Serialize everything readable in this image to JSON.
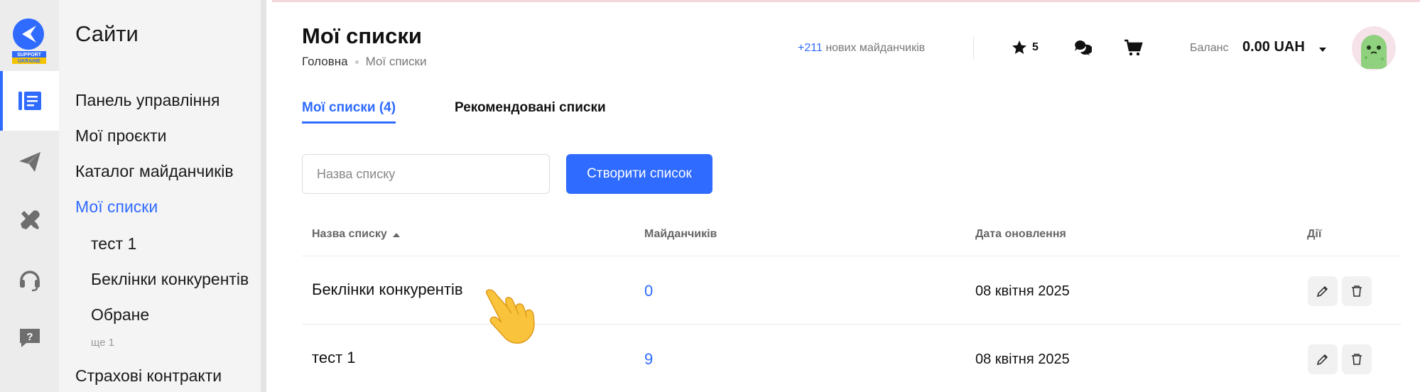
{
  "sidebar": {
    "logo_text_1": "SUPPORT",
    "logo_text_2": "UKRAINE",
    "icons": [
      "list-icon",
      "send-icon",
      "tools-icon",
      "headset-icon",
      "help-icon"
    ],
    "active_icon": "list-icon",
    "accent": "#2f6bff"
  },
  "menu": {
    "title": "Сайти",
    "items": [
      {
        "label": "Панель управління"
      },
      {
        "label": "Мої проєкти"
      },
      {
        "label": "Каталог майданчиків"
      },
      {
        "label": "Мої списки",
        "active": true
      }
    ],
    "sublists": [
      {
        "label": "тест 1"
      },
      {
        "label": "Беклінки конкурентів"
      },
      {
        "label": "Обране"
      }
    ],
    "more": "ще 1",
    "last_item": "Страхові контракти"
  },
  "header": {
    "title": "Мої списки",
    "breadcrumb": [
      "Головна",
      "Мої списки"
    ],
    "new_sites_count": "+211",
    "new_sites_text": "нових майданчиків",
    "favorites_count": "5",
    "balance_label": "Баланс",
    "balance_value": "0.00 UAH"
  },
  "tabs": [
    {
      "label": "Мої списки (4)",
      "active": true
    },
    {
      "label": "Рекомендовані списки",
      "active": false
    }
  ],
  "search": {
    "placeholder": "Назва списку",
    "value": ""
  },
  "create_button": "Створити список",
  "table": {
    "columns": [
      "Назва списку",
      "Майданчиків",
      "Дата оновлення",
      "Дії"
    ],
    "rows": [
      {
        "name": "Беклінки конкурентів",
        "count": "0",
        "date": "08 квітня 2025"
      },
      {
        "name": "тест 1",
        "count": "9",
        "date": "08 квітня 2025"
      }
    ]
  }
}
